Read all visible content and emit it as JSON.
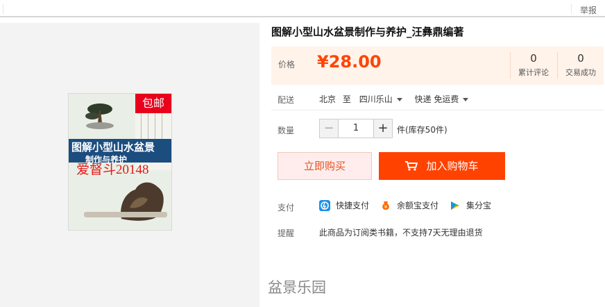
{
  "topbar": {
    "report": "举报"
  },
  "product": {
    "title": "图解小型山水盆景制作与养护_汪彝鼎编著",
    "cover": {
      "title": "图解小型山水盆景",
      "subtitle": "制作与养护",
      "free_shipping_tag": "包邮",
      "watermark": "爱督斗20148"
    }
  },
  "price": {
    "label": "价格",
    "value": "¥28.00",
    "stats": [
      {
        "num": "0",
        "label": "累计评论"
      },
      {
        "num": "0",
        "label": "交易成功"
      }
    ]
  },
  "delivery": {
    "label": "配送",
    "from": "北京",
    "to_word": "至",
    "destination": "四川乐山",
    "shipping": "快递 免运费"
  },
  "quantity": {
    "label": "数量",
    "minus": "−",
    "value": "1",
    "plus": "+",
    "stock": "件(库存50件)"
  },
  "actions": {
    "buy_now": "立即购买",
    "add_cart": "加入购物车"
  },
  "payment": {
    "label": "支付",
    "methods": [
      {
        "name": "快捷支付",
        "icon": "quickpay-icon",
        "color": "#1e90e8"
      },
      {
        "name": "余额宝支付",
        "icon": "yuebao-icon",
        "color": "#ff6a00"
      },
      {
        "name": "集分宝",
        "icon": "jifenbao-icon",
        "color": "#2fb36f"
      }
    ]
  },
  "notice": {
    "label": "提醒",
    "text": "此商品为订阅类书籍，不支持7天无理由退货"
  },
  "shop": {
    "name": "盆景乐园"
  },
  "colors": {
    "accent": "#ff4200",
    "price": "#ff4400",
    "price_bg": "#fff3ea"
  }
}
